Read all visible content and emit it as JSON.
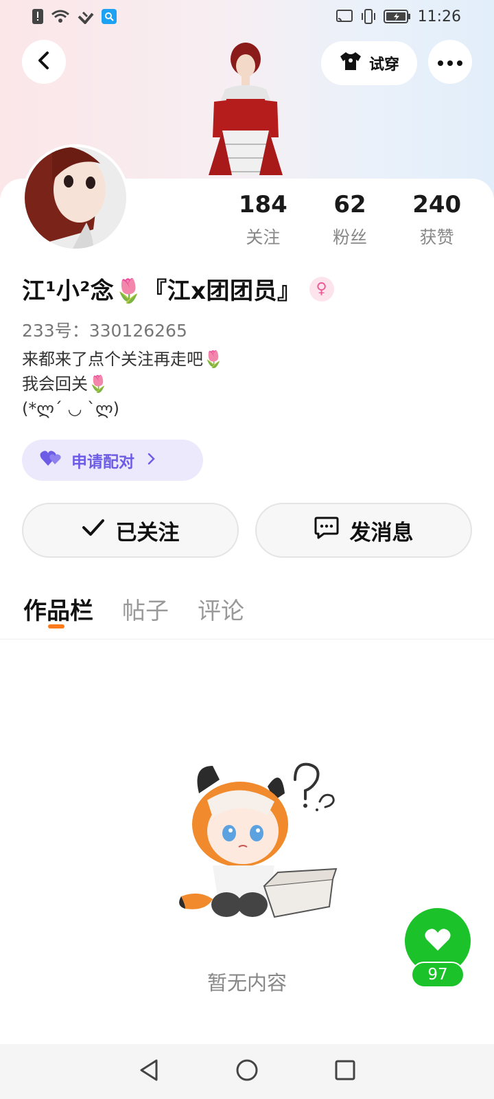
{
  "status_bar": {
    "time": "11:26",
    "left_icons": [
      "alert-icon",
      "wifi-icon",
      "heart-signal-icon",
      "search-app-icon"
    ],
    "right_icons": [
      "cast-icon",
      "vibrate-icon",
      "battery-icon"
    ]
  },
  "header": {
    "tryon_label": "试穿"
  },
  "stats": [
    {
      "value": "184",
      "label": "关注"
    },
    {
      "value": "62",
      "label": "粉丝"
    },
    {
      "value": "240",
      "label": "获赞"
    }
  ],
  "profile": {
    "nickname": "江¹小²念🌷『江x团团员』",
    "uid": "233号：330126265",
    "bio_lines": [
      "来都来了点个关注再走吧🌷",
      "我会回关🌷",
      "(*ლ´ ◡ `ლ)"
    ],
    "gender_symbol": "♀"
  },
  "pair_button": {
    "label": "申请配对"
  },
  "actions": {
    "follow_label": "已关注",
    "message_label": "发消息"
  },
  "tabs": [
    {
      "label": "作品栏",
      "active": true
    },
    {
      "label": "帖子",
      "active": false
    },
    {
      "label": "评论",
      "active": false
    }
  ],
  "empty_state": {
    "text": "暂无内容"
  },
  "like_fab": {
    "count": "97"
  },
  "colors": {
    "accent_orange": "#ff7a1a",
    "pair_purple": "#6d5ce6",
    "like_green": "#1bc22a"
  }
}
